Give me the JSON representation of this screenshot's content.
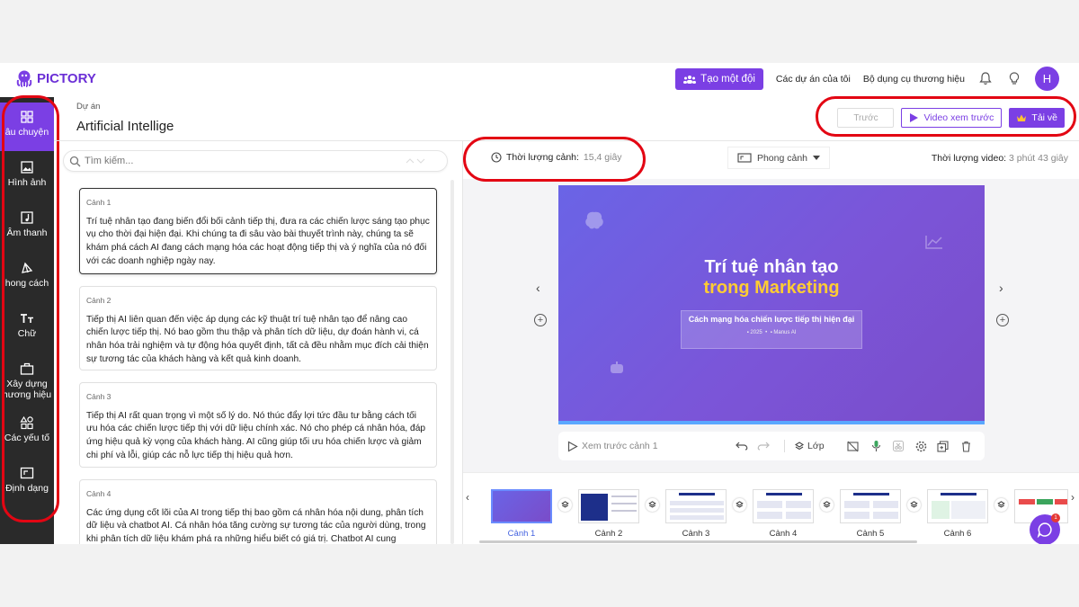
{
  "brand": {
    "name": "PICTORY",
    "accent": "#7b3fe4"
  },
  "topnav": {
    "team_button": "Tạo một đội",
    "projects_link": "Các dự án của tôi",
    "brand_kit_link": "Bộ dụng cụ thương hiệu",
    "avatar_initial": "H"
  },
  "sidebar": {
    "items": [
      {
        "label": "âu chuyện",
        "icon": "grid-icon"
      },
      {
        "label": "Hình ảnh",
        "icon": "image-icon"
      },
      {
        "label": "Âm thanh",
        "icon": "music-icon"
      },
      {
        "label": "hong cách",
        "icon": "style-icon"
      },
      {
        "label": "Chữ",
        "icon": "text-icon"
      },
      {
        "label": "Xây dựng",
        "label2": "hương hiệu",
        "icon": "briefcase-icon"
      },
      {
        "label": "Các yếu tố",
        "icon": "elements-icon"
      },
      {
        "label": "Định dạng",
        "icon": "format-icon"
      }
    ]
  },
  "project": {
    "label": "Dự án",
    "title": "Artificial Intellige"
  },
  "actions": {
    "prev": "Trước",
    "preview_video": "Video xem trước",
    "download": "Tải về"
  },
  "story": {
    "search_placeholder": "Tìm kiếm...",
    "scenes": [
      {
        "label": "Cảnh 1",
        "text": "Trí tuệ nhân tạo đang biến đổi bối cảnh tiếp thị, đưa ra các chiến lược sáng tạo phục vụ cho thời đại hiện đại. Khi chúng ta đi sâu vào bài thuyết trình này, chúng ta sẽ khám phá cách AI đang cách mạng hóa các hoạt động tiếp thị và ý nghĩa của nó đối với các doanh nghiệp ngày nay."
      },
      {
        "label": "Cảnh 2",
        "text": "Tiếp thị AI liên quan đến việc áp dụng các kỹ thuật trí tuệ nhân tạo để nâng cao chiến lược tiếp thị. Nó bao gồm thu thập và phân tích dữ liệu, dự đoán hành vi, cá nhân hóa trải nghiệm và tự động hóa quyết định, tất cả đều nhằm mục đích cải thiện sự tương tác của khách hàng và kết quả kinh doanh."
      },
      {
        "label": "Cảnh 3",
        "text": "Tiếp thị AI rất quan trọng vì một số lý do. Nó thúc đẩy lợi tức đầu tư bằng cách tối ưu hóa các chiến lược tiếp thị với dữ liệu chính xác. Nó cho phép cá nhân hóa, đáp ứng hiệu quả kỳ vọng của khách hàng. AI cũng giúp tối ưu hóa chiến lược và giảm chi phí và lỗi, giúp các nỗ lực tiếp thị hiệu quả hơn."
      },
      {
        "label": "Cảnh 4",
        "text": "Các ứng dụng cốt lõi của AI trong tiếp thị bao gồm cá nhân hóa nội dung, phân tích dữ liệu và chatbot AI. Cá nhân hóa tăng cường sự tương tác của người dùng, trong khi phân tích dữ liệu khám phá ra những hiểu biết có giá trị. Chatbot AI cung"
      }
    ]
  },
  "workspace": {
    "scene_duration_label": "Thời lượng cảnh:",
    "scene_duration_value": "15,4 giây",
    "orientation": "Phong cảnh",
    "video_duration_label": "Thời lượng video:",
    "video_duration_value": "3 phút 43 giây"
  },
  "preview": {
    "title": "Trí tuệ nhân tạo",
    "title_highlight": "trong Marketing",
    "subtitle": "Cách mạng hóa chiến lược tiếp thị hiện đại",
    "year": "2025",
    "author": "Manus AI",
    "highlight_color": "#ffcc33"
  },
  "toolbar": {
    "preview_scene": "Xem trước cảnh 1",
    "layer": "Lớp"
  },
  "filmstrip": {
    "scenes": [
      "Cảnh 1",
      "Cảnh 2",
      "Cảnh 3",
      "Cảnh 4",
      "Cảnh 5",
      "Cảnh 6"
    ],
    "chat_badge": "1"
  }
}
